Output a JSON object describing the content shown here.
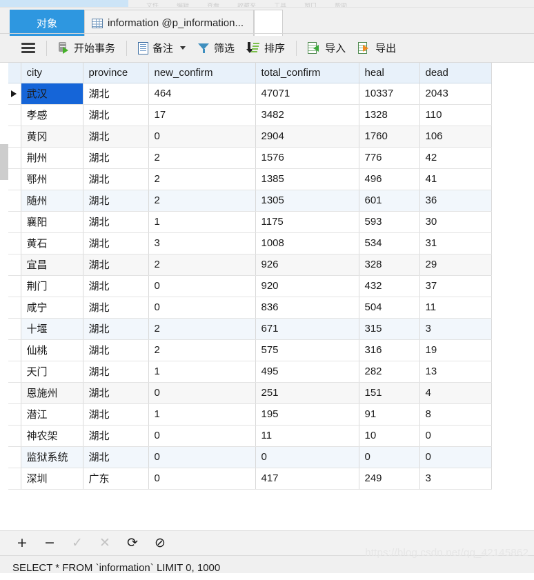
{
  "menu_strip": {
    "items": [
      "文件",
      "编辑",
      "查看",
      "收藏夹",
      "工具",
      "窗口",
      "帮助"
    ]
  },
  "tabs": {
    "object_tab": "对象",
    "doc_tab": "information @p_information...",
    "doc_tab_icon": "grid-table-icon"
  },
  "toolbar": {
    "menu_icon": "hamburger-icon",
    "begin_transaction": "开始事务",
    "note": "备注",
    "filter": "筛选",
    "sort": "排序",
    "import": "导入",
    "export": "导出"
  },
  "grid": {
    "columns": [
      "city",
      "province",
      "new_confirm",
      "total_confirm",
      "heal",
      "dead"
    ],
    "selected_cell": {
      "row": 0,
      "column": 0
    },
    "rows": [
      {
        "city": "武汉",
        "province": "湖北",
        "new_confirm": "464",
        "total_confirm": "47071",
        "heal": "10337",
        "dead": "2043"
      },
      {
        "city": "孝感",
        "province": "湖北",
        "new_confirm": "17",
        "total_confirm": "3482",
        "heal": "1328",
        "dead": "110"
      },
      {
        "city": "黄冈",
        "province": "湖北",
        "new_confirm": "0",
        "total_confirm": "2904",
        "heal": "1760",
        "dead": "106"
      },
      {
        "city": "荆州",
        "province": "湖北",
        "new_confirm": "2",
        "total_confirm": "1576",
        "heal": "776",
        "dead": "42"
      },
      {
        "city": "鄂州",
        "province": "湖北",
        "new_confirm": "2",
        "total_confirm": "1385",
        "heal": "496",
        "dead": "41"
      },
      {
        "city": "随州",
        "province": "湖北",
        "new_confirm": "2",
        "total_confirm": "1305",
        "heal": "601",
        "dead": "36"
      },
      {
        "city": "襄阳",
        "province": "湖北",
        "new_confirm": "1",
        "total_confirm": "1175",
        "heal": "593",
        "dead": "30"
      },
      {
        "city": "黄石",
        "province": "湖北",
        "new_confirm": "3",
        "total_confirm": "1008",
        "heal": "534",
        "dead": "31"
      },
      {
        "city": "宜昌",
        "province": "湖北",
        "new_confirm": "2",
        "total_confirm": "926",
        "heal": "328",
        "dead": "29"
      },
      {
        "city": "荆门",
        "province": "湖北",
        "new_confirm": "0",
        "total_confirm": "920",
        "heal": "432",
        "dead": "37"
      },
      {
        "city": "咸宁",
        "province": "湖北",
        "new_confirm": "0",
        "total_confirm": "836",
        "heal": "504",
        "dead": "11"
      },
      {
        "city": "十堰",
        "province": "湖北",
        "new_confirm": "2",
        "total_confirm": "671",
        "heal": "315",
        "dead": "3"
      },
      {
        "city": "仙桃",
        "province": "湖北",
        "new_confirm": "2",
        "total_confirm": "575",
        "heal": "316",
        "dead": "19"
      },
      {
        "city": "天门",
        "province": "湖北",
        "new_confirm": "1",
        "total_confirm": "495",
        "heal": "282",
        "dead": "13"
      },
      {
        "city": "恩施州",
        "province": "湖北",
        "new_confirm": "0",
        "total_confirm": "251",
        "heal": "151",
        "dead": "4"
      },
      {
        "city": "潜江",
        "province": "湖北",
        "new_confirm": "1",
        "total_confirm": "195",
        "heal": "91",
        "dead": "8"
      },
      {
        "city": "神农架",
        "province": "湖北",
        "new_confirm": "0",
        "total_confirm": "11",
        "heal": "10",
        "dead": "0"
      },
      {
        "city": "监狱系统",
        "province": "湖北",
        "new_confirm": "0",
        "total_confirm": "0",
        "heal": "0",
        "dead": "0"
      },
      {
        "city": "深圳",
        "province": "广东",
        "new_confirm": "0",
        "total_confirm": "417",
        "heal": "249",
        "dead": "3"
      }
    ]
  },
  "bottom_nav": {
    "add": "+",
    "remove": "−",
    "apply": "✓",
    "cancel": "✕",
    "refresh": "⟳",
    "stop": "⊘"
  },
  "status": {
    "sql": "SELECT * FROM `information` LIMIT 0, 1000"
  },
  "watermark": "https://blog.csdn.net/qq_42145862",
  "colors": {
    "accent_blue": "#2e97e0",
    "selection_blue": "#1565d8",
    "header_blue": "#e8f1fa",
    "toolbar_bg": "#f0f0f0"
  }
}
